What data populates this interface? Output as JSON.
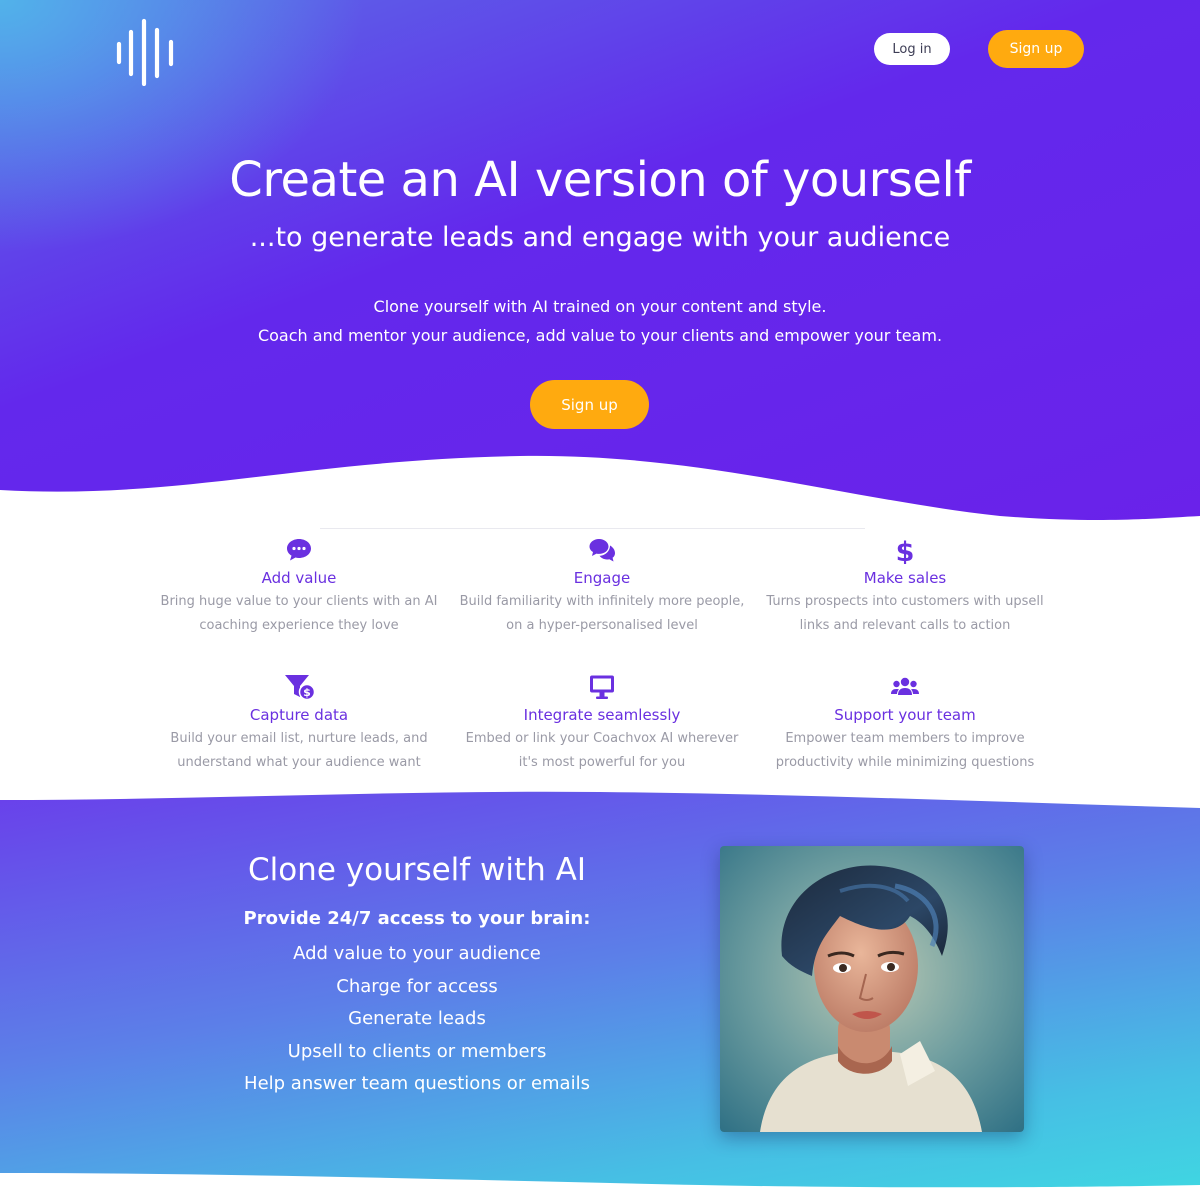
{
  "header": {
    "logo_icon": "sound-wave-icon",
    "login_label": "Log in",
    "signup_label": "Sign up"
  },
  "hero": {
    "title": "Create an AI version of yourself",
    "subtitle": "...to generate leads and engage with your audience",
    "description_line1": "Clone yourself with AI trained on your content and style.",
    "description_line2": "Coach and mentor your audience, add value to your clients and empower your team.",
    "cta_label": "Sign up"
  },
  "features": [
    {
      "icon": "chat-bubble-icon",
      "title": "Add value",
      "line1": "Bring huge value to your clients with an AI",
      "line2": "coaching experience they love"
    },
    {
      "icon": "comments-icon",
      "title": "Engage",
      "line1": "Build familiarity with infinitely more people,",
      "line2": "on a hyper-personalised level"
    },
    {
      "icon": "dollar-icon",
      "title": "Make sales",
      "line1": "Turns prospects into customers with upsell",
      "line2": "links and relevant calls to action"
    },
    {
      "icon": "funnel-dollar-icon",
      "title": "Capture data",
      "line1": "Build your email list, nurture leads, and",
      "line2": "understand what your audience want"
    },
    {
      "icon": "monitor-icon",
      "title": "Integrate seamlessly",
      "line1": "Embed or link your Coachvox AI wherever",
      "line2": "it's most powerful for you"
    },
    {
      "icon": "users-icon",
      "title": "Support your team",
      "line1": "Empower team members to improve",
      "line2": "productivity while minimizing questions"
    }
  ],
  "clone": {
    "title": "Clone yourself with AI",
    "lead": "Provide 24/7 access to your brain:",
    "items": [
      "Add value to your audience",
      "Charge for access",
      "Generate leads",
      "Upsell to clients or members",
      "Help answer team questions or emails"
    ]
  },
  "colors": {
    "accent_orange": "#ffaa0f",
    "brand_purple": "#6a30e0",
    "hero_purple": "#6328ec",
    "teal": "#3fd8e2"
  }
}
